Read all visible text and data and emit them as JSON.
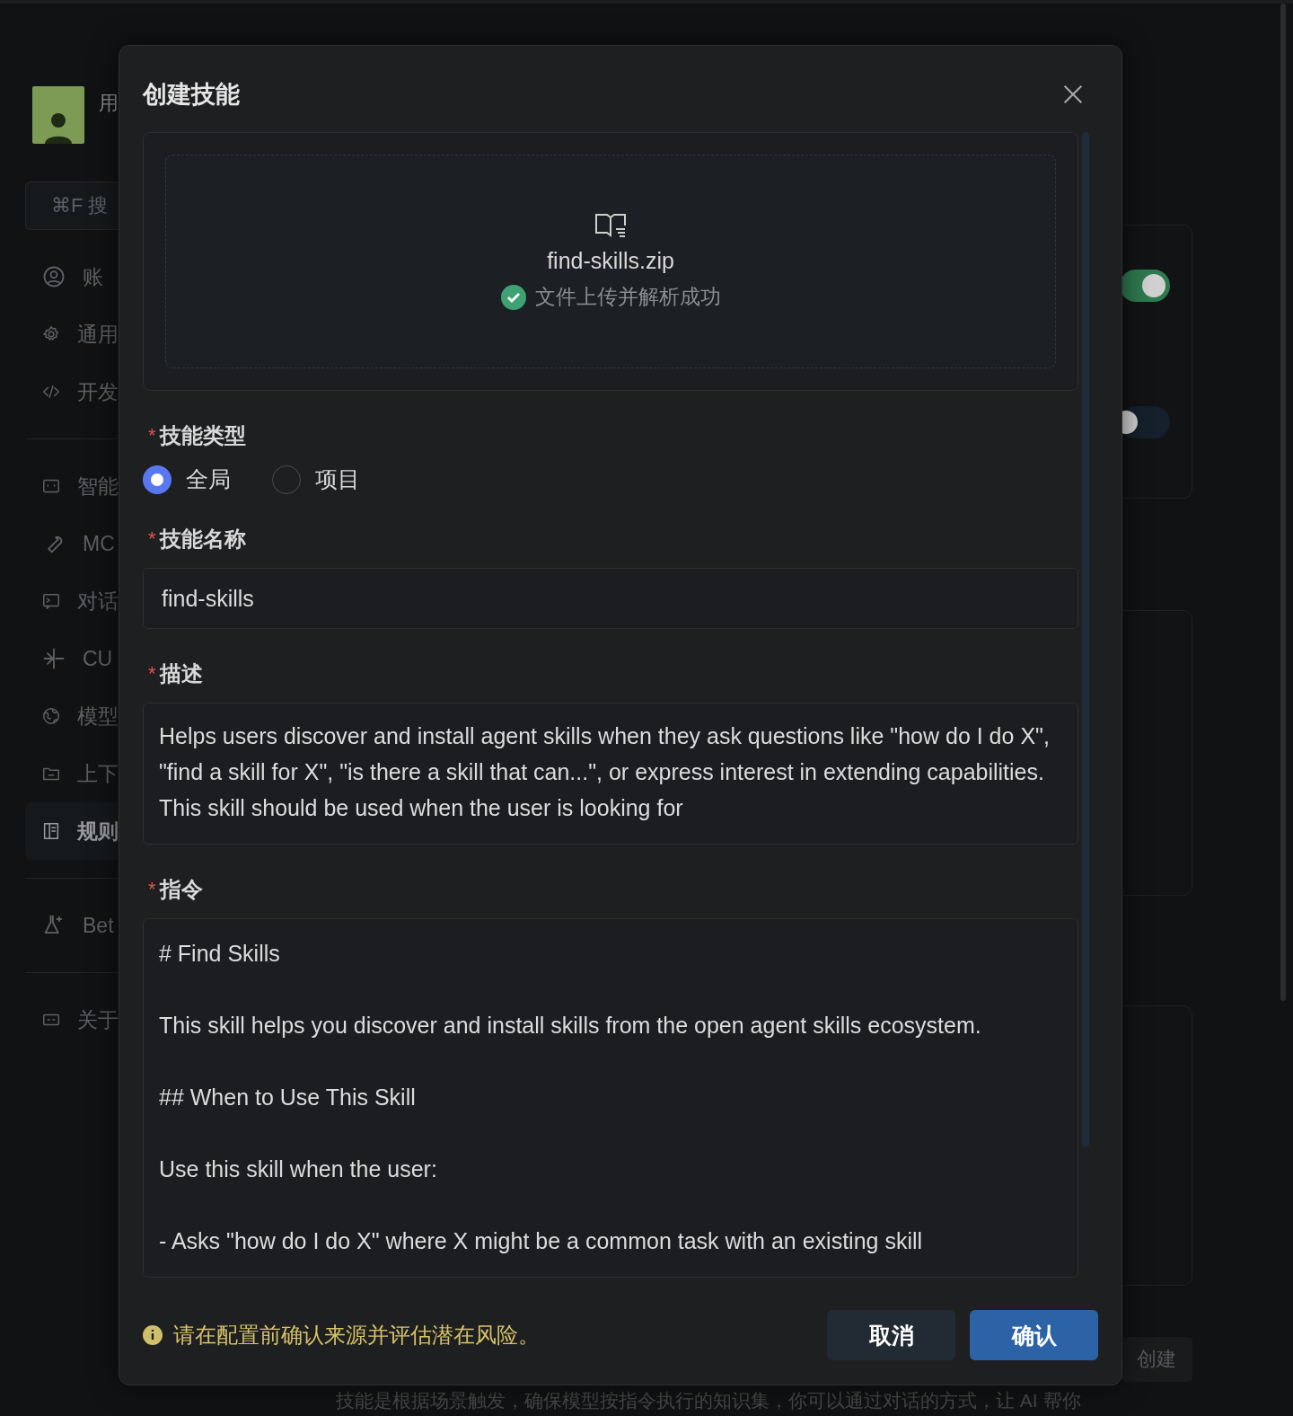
{
  "sidebar": {
    "user": {
      "name": "用"
    },
    "search": {
      "shortcut": "⌘F",
      "placeholder": "搜"
    },
    "groups": [
      [
        {
          "label": "账",
          "selected": false
        },
        {
          "label": "通用",
          "selected": false
        },
        {
          "label": "开发",
          "selected": false
        }
      ],
      [
        {
          "label": "智能",
          "selected": false
        },
        {
          "label": "MC",
          "selected": false
        },
        {
          "label": "对话",
          "selected": false
        },
        {
          "label": "CU",
          "selected": false
        },
        {
          "label": "模型",
          "selected": false
        },
        {
          "label": "上下",
          "selected": false
        },
        {
          "label": "规则",
          "selected": true
        }
      ],
      [
        {
          "label": "Bet",
          "selected": false
        }
      ],
      [
        {
          "label": "关于",
          "selected": false
        }
      ]
    ]
  },
  "background": {
    "toggles": [
      {
        "on": true
      },
      {
        "on": false
      }
    ],
    "create_button": "创建",
    "hint": "技能是根据场景触发，确保模型按指令执行的知识集，你可以通过对话的方式，让 AI 帮你"
  },
  "dialog": {
    "title": "创建技能",
    "upload": {
      "file_name": "find-skills.zip",
      "status": "文件上传并解析成功"
    },
    "type_field": {
      "label": "技能类型",
      "required_mark": "*",
      "options": [
        {
          "label": "全局",
          "selected": true
        },
        {
          "label": "项目",
          "selected": false
        }
      ]
    },
    "name_field": {
      "label": "技能名称",
      "required_mark": "*",
      "value": "find-skills"
    },
    "description_field": {
      "label": "描述",
      "required_mark": "*",
      "value": "Helps users discover and install agent skills when they ask questions like \"how do I do X\", \"find a skill for X\", \"is there a skill that can...\", or express interest in extending capabilities. This skill should be used when the user is looking for"
    },
    "instructions_field": {
      "label": "指令",
      "required_mark": "*",
      "paragraphs": [
        "# Find Skills",
        "This skill helps you discover and install skills from the open agent skills ecosystem.",
        "## When to Use This Skill",
        "Use this skill when the user:",
        "- Asks \"how do I do X\" where X might be a common task with an existing skill"
      ]
    },
    "warning": "请在配置前确认来源并评估潜在风险。",
    "buttons": [
      {
        "label": "取消",
        "kind": "secondary"
      },
      {
        "label": "确认",
        "kind": "primary"
      }
    ]
  }
}
